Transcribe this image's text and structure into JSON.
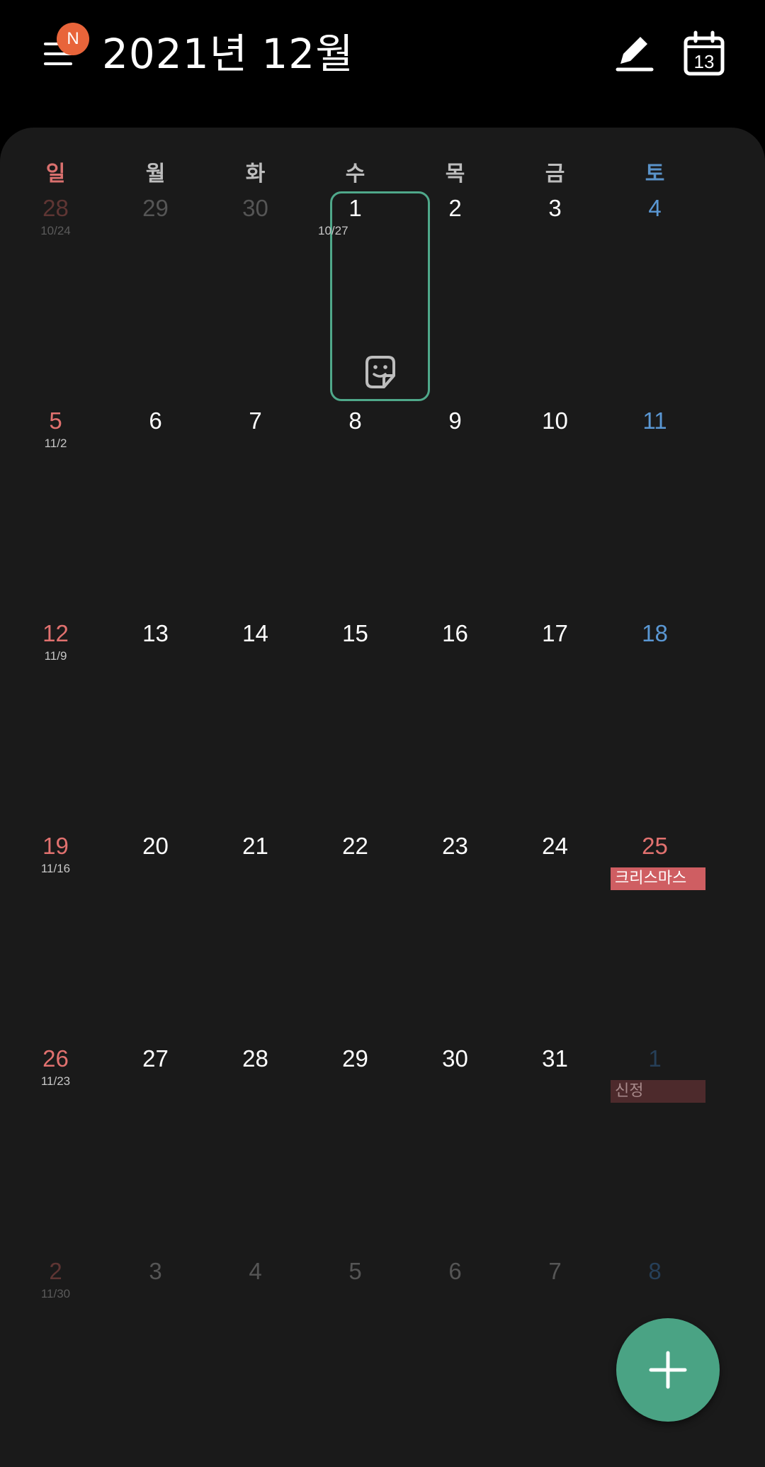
{
  "header": {
    "title": "2021년 12월",
    "badge": "N",
    "calendar_icon_day": "13"
  },
  "weekdays": [
    "일",
    "월",
    "화",
    "수",
    "목",
    "금",
    "토"
  ],
  "weeks": [
    [
      {
        "day": "28",
        "lunar": "10/24",
        "dim": true
      },
      {
        "day": "29",
        "dim": true
      },
      {
        "day": "30",
        "dim": true
      },
      {
        "day": "1",
        "lunar": "10/27"
      },
      {
        "day": "2"
      },
      {
        "day": "3"
      },
      {
        "day": "4"
      }
    ],
    [
      {
        "day": "5",
        "lunar": "11/2"
      },
      {
        "day": "6"
      },
      {
        "day": "7"
      },
      {
        "day": "8"
      },
      {
        "day": "9"
      },
      {
        "day": "10"
      },
      {
        "day": "11"
      }
    ],
    [
      {
        "day": "12",
        "lunar": "11/9"
      },
      {
        "day": "13"
      },
      {
        "day": "14"
      },
      {
        "day": "15"
      },
      {
        "day": "16"
      },
      {
        "day": "17"
      },
      {
        "day": "18"
      }
    ],
    [
      {
        "day": "19",
        "lunar": "11/16"
      },
      {
        "day": "20"
      },
      {
        "day": "21"
      },
      {
        "day": "22"
      },
      {
        "day": "23"
      },
      {
        "day": "24"
      },
      {
        "day": "25",
        "event": "크리스마스",
        "holiday": true
      }
    ],
    [
      {
        "day": "26",
        "lunar": "11/23"
      },
      {
        "day": "27"
      },
      {
        "day": "28"
      },
      {
        "day": "29"
      },
      {
        "day": "30"
      },
      {
        "day": "31"
      },
      {
        "day": "1",
        "dim": true,
        "event": "신정"
      }
    ],
    [
      {
        "day": "2",
        "lunar": "11/30",
        "dim": true
      },
      {
        "day": "3",
        "dim": true
      },
      {
        "day": "4",
        "dim": true
      },
      {
        "day": "5",
        "dim": true
      },
      {
        "day": "6",
        "dim": true
      },
      {
        "day": "7",
        "dim": true
      },
      {
        "day": "8",
        "dim": true
      }
    ]
  ],
  "colors": {
    "accent": "#4aa384",
    "sunday": "#e1716f",
    "saturday": "#5a97d3",
    "holiday": "#cf5e62",
    "badge": "#e8643a"
  }
}
